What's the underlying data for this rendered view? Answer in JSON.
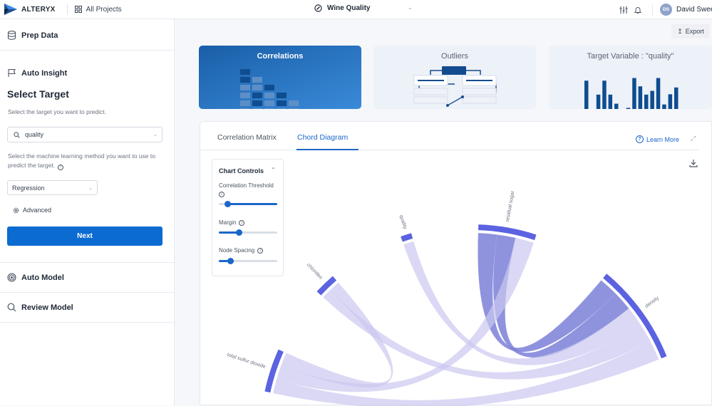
{
  "topbar": {
    "brand": "ALTERYX",
    "all_projects": "All Projects",
    "project": "Wine Quality",
    "user_initials": "DS",
    "user_name": "David Sweeney"
  },
  "sidebar": {
    "prep_data": "Prep Data",
    "auto_insight": "Auto Insight",
    "select_target_title": "Select Target",
    "target_hint": "Select the target you want to predict.",
    "target_value": "quality",
    "method_hint": "Select the machine learning method you want to use to predict the target.",
    "method_value": "Regression",
    "advanced": "Advanced",
    "next": "Next",
    "auto_model": "Auto Model",
    "review_model": "Review Model"
  },
  "main": {
    "export": "Export",
    "cards": [
      {
        "title": "Correlations",
        "active": true
      },
      {
        "title": "Outliers",
        "active": false
      },
      {
        "title": "Target Variable : \"quality\"",
        "active": false
      }
    ],
    "tabs": [
      {
        "label": "Correlation Matrix",
        "active": false
      },
      {
        "label": "Chord Diagram",
        "active": true
      }
    ],
    "learn_more": "Learn More",
    "chart_controls": {
      "title": "Chart Controls",
      "correlation_threshold": {
        "label": "Correlation Threshold",
        "value": 0.15
      },
      "margin": {
        "label": "Margin",
        "value": 0.35
      },
      "node_spacing": {
        "label": "Node Spacing",
        "value": 0.2
      }
    }
  },
  "chart_data": {
    "type": "chord",
    "nodes": [
      "quality",
      "residual sugar",
      "density",
      "chlorides",
      "total sulfur dioxide"
    ],
    "links": [
      {
        "source": "residual sugar",
        "target": "density",
        "strength": "strong"
      },
      {
        "source": "density",
        "target": "residual sugar",
        "strength": "strong"
      },
      {
        "source": "quality",
        "target": "density",
        "strength": "weak"
      },
      {
        "source": "chlorides",
        "target": "density",
        "strength": "weak"
      },
      {
        "source": "total sulfur dioxide",
        "target": "density",
        "strength": "weak"
      },
      {
        "source": "total sulfur dioxide",
        "target": "residual sugar",
        "strength": "weak"
      },
      {
        "source": "chlorides",
        "target": "total sulfur dioxide",
        "strength": "weak"
      }
    ],
    "colors": {
      "node": "#5b63e0",
      "strong": "#7b80d8",
      "weak": "#cbc8f0"
    }
  }
}
